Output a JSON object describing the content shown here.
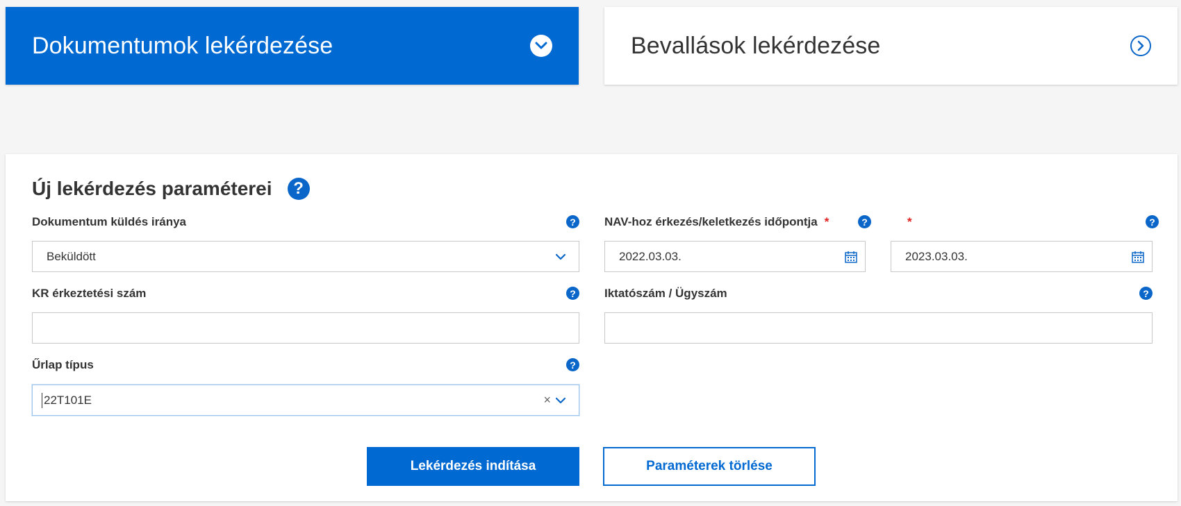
{
  "tabs": {
    "active": {
      "label": "Dokumentumok lekérdezése"
    },
    "inactive": {
      "label": "Bevallások lekérdezése"
    }
  },
  "panel": {
    "title": "Új lekérdezés paraméterei",
    "help_glyph": "?"
  },
  "fields": {
    "direction": {
      "label": "Dokumentum küldés iránya",
      "value": "Beküldött"
    },
    "date": {
      "label": "NAV-hoz érkezés/keletkezés időpontja",
      "required_mark": "*",
      "from": "2022.03.03.",
      "to": "2023.03.03."
    },
    "kr_number": {
      "label": "KR érkeztetési szám",
      "value": ""
    },
    "case_number": {
      "label": "Iktatószám / Ügyszám",
      "value": ""
    },
    "form_type": {
      "label": "Űrlap típus",
      "value": "22T101E",
      "clear_glyph": "×"
    }
  },
  "buttons": {
    "start": "Lekérdezés indítása",
    "clear": "Paraméterek törlése"
  },
  "colors": {
    "accent": "#0069d2",
    "help": "#0a66c8",
    "required": "#e02020"
  }
}
